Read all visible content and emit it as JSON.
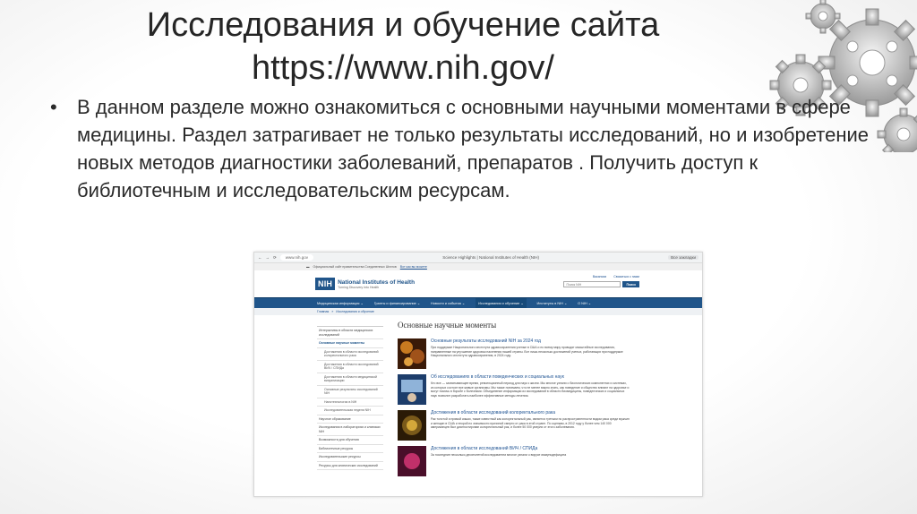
{
  "slide": {
    "title_line1": "Исследования и обучение сайта",
    "title_line2": "https://www.nih.gov/",
    "bullet": "В данном разделе можно ознакомиться с основными научными моментами в сфере медицины. Раздел затрагивает не только результаты исследований, но и изобретение новых методов диагностики заболеваний, препаратов .  Получить доступ к библиотечным и исследовательским ресурсам."
  },
  "browser": {
    "url": "www.nih.gov",
    "tab_title": "Science Highlights | National Institutes of Health (NIH)",
    "right_buttons": [
      "Все закладки"
    ]
  },
  "gov_banner": {
    "text": "Официальный сайт правительства Соединенных Штатов",
    "link": "Вот как вы можете"
  },
  "nih_header": {
    "logo": "NIH",
    "name": "National Institutes of Health",
    "tagline": "Turning Discovery Into Health",
    "top_links": [
      "Вакансии",
      "Связаться с нами"
    ],
    "search_placeholder": "Поиск NIH",
    "search_button": "Поиск"
  },
  "nav": {
    "items": [
      "Медицинская информация ⌄",
      "Гранты и финансирование ⌄",
      "Новости и события ⌄",
      "Исследования и обучение ⌄",
      "Институты в NIH ⌄",
      "О NIH ⌄"
    ],
    "active_index": 3
  },
  "breadcrumb": {
    "home": "Главная",
    "separator": "»",
    "current": "Исследования и обучение"
  },
  "sidebar": {
    "items": [
      {
        "label": "Интерактивы в области медицинских исследований",
        "type": "normal"
      },
      {
        "label": "Основные научные моменты",
        "type": "active"
      },
      {
        "label": "Достижения в области исследований колоректального рака",
        "type": "sub"
      },
      {
        "label": "Достижения в области исследований ВИЧ / СПИДа",
        "type": "sub"
      },
      {
        "label": "Достижения в области медицинской визуализации",
        "type": "sub"
      },
      {
        "label": "Основные результаты исследований NIH",
        "type": "sub"
      },
      {
        "label": "Нанотехнологии в NIH",
        "type": "sub"
      },
      {
        "label": "Исследовательская неделя NIH",
        "type": "sub"
      },
      {
        "label": "Научное образование",
        "type": "normal"
      },
      {
        "label": "Исследования в лабораториях и клиниках NIH",
        "type": "normal"
      },
      {
        "label": "Возможности для обучения",
        "type": "normal"
      },
      {
        "label": "Библиотечные ресурсы",
        "type": "normal"
      },
      {
        "label": "Исследовательские ресурсы",
        "type": "normal"
      },
      {
        "label": "Ресурсы для клинических исследований",
        "type": "normal"
      }
    ]
  },
  "main": {
    "title": "Основные научные моменты",
    "articles": [
      {
        "title": "Основные результаты исследований NIH за 2024 год",
        "body": "При поддержке Национального института здравоохранения ученые в США и по всему миру проводят масштабные исследования, направленные на улучшение здоровья населения нашей страны. Вот лишь несколько достижений ученых, работающих при поддержке Национального института здравоохранения, в 2024 году."
      },
      {
        "title": "Об исследованиях в области поведенческих и социальных наук",
        "body": "Кто все — захватывающее время, революционный период для наук о жизни. Мы многое узнали о биологических компонентах и системах, из которых состоят все живые организмы. Мы также понимаем, что не менее важно знать, как поведение и общество влияют на здоровье и могут помочь в борьбе с болезнями. Объединение информации из исследований в области биомедицины, поведенческих и социальных наук позволит разработать наиболее эффективные методы лечения."
      },
      {
        "title": "Достижения в области исследований колоректального рака",
        "body": "Рак толстой и прямой кишки, также известный как колоректальный рак, является третьим по распространенности видом рака среди мужчин и женщин в США и второй по значимости причиной смерти от рака в этой стране. По оценкам, в 2012 году у более чем 140 000 американцев был диагностирован колоректальный рак, и более 50 000 умерли от этого заболевания."
      },
      {
        "title": "Достижения в области исследований ВИЧ / СПИДа",
        "body": "За последние несколько десятилетий исследователи многое узнали о вирусе иммунодефицита"
      }
    ]
  },
  "colors": {
    "nih_blue": "#20558a",
    "link_blue": "#205493",
    "title_text": "#262626"
  }
}
